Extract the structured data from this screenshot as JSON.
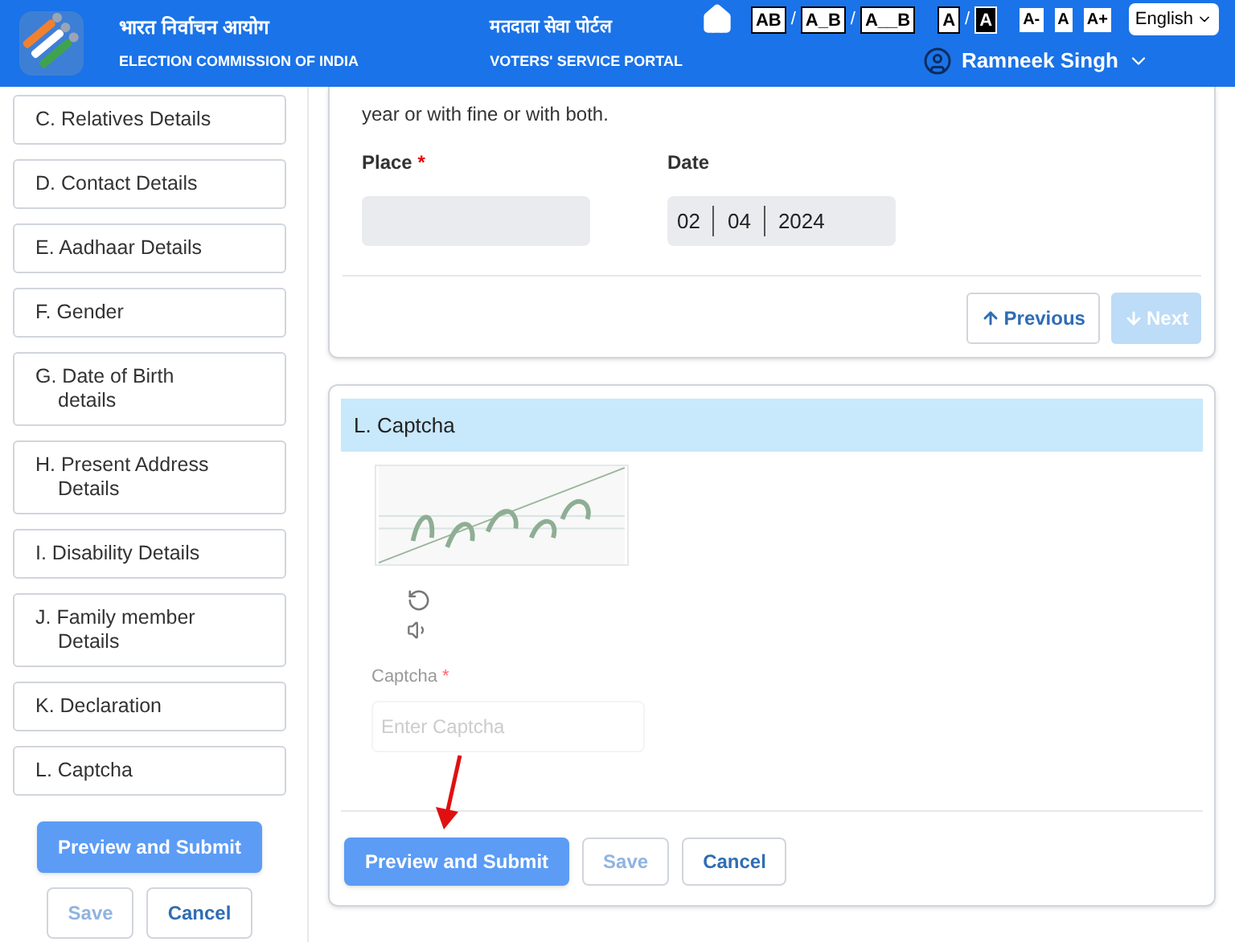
{
  "header": {
    "org_hindi": "भारत निर्वाचन आयोग",
    "org_english": "ELECTION COMMISSION OF INDIA",
    "portal_hindi": "मतदाता सेवा पोर्टल",
    "portal_english": "VOTERS' SERVICE PORTAL",
    "spacing_options": [
      "AB",
      "A_B",
      "A__B"
    ],
    "separator": "/",
    "contrast_options": [
      {
        "label": "A",
        "kind": "light"
      },
      {
        "label": "A",
        "kind": "dark"
      }
    ],
    "size_options": [
      "A-",
      "A",
      "A+"
    ],
    "language": "English",
    "user": "Ramneek Singh"
  },
  "sidebar": {
    "items": [
      "C. Relatives Details",
      "D. Contact Details",
      "E. Aadhaar Details",
      "F. Gender",
      "G. Date of Birth details",
      "H. Present Address Details",
      "I. Disability Details",
      "J. Family member Details",
      "K. Declaration",
      "L. Captcha"
    ],
    "buttons": [
      {
        "label": "Preview and Submit",
        "kind": "primary"
      },
      {
        "label": "Save",
        "kind": "outline",
        "disabled": true
      },
      {
        "label": "Cancel",
        "kind": "outline",
        "disabled": false
      }
    ]
  },
  "declaration": {
    "text": "year or with fine or with both.",
    "place_label": "Place",
    "place_required_mark": "*",
    "date_label": "Date",
    "date": [
      "02",
      "04",
      "2024"
    ],
    "nav": [
      {
        "label": "Previous",
        "kind": "up",
        "disabled": false
      },
      {
        "label": "Next",
        "kind": "down",
        "disabled": true
      }
    ]
  },
  "captcha": {
    "title": "L. Captcha",
    "field_label": "Captcha",
    "required_mark": "*",
    "placeholder": "Enter Captcha",
    "buttons": [
      {
        "label": "Preview and Submit",
        "kind": "primary"
      },
      {
        "label": "Save",
        "kind": "outline",
        "disabled": true
      },
      {
        "label": "Cancel",
        "kind": "outline",
        "disabled": false
      }
    ]
  }
}
